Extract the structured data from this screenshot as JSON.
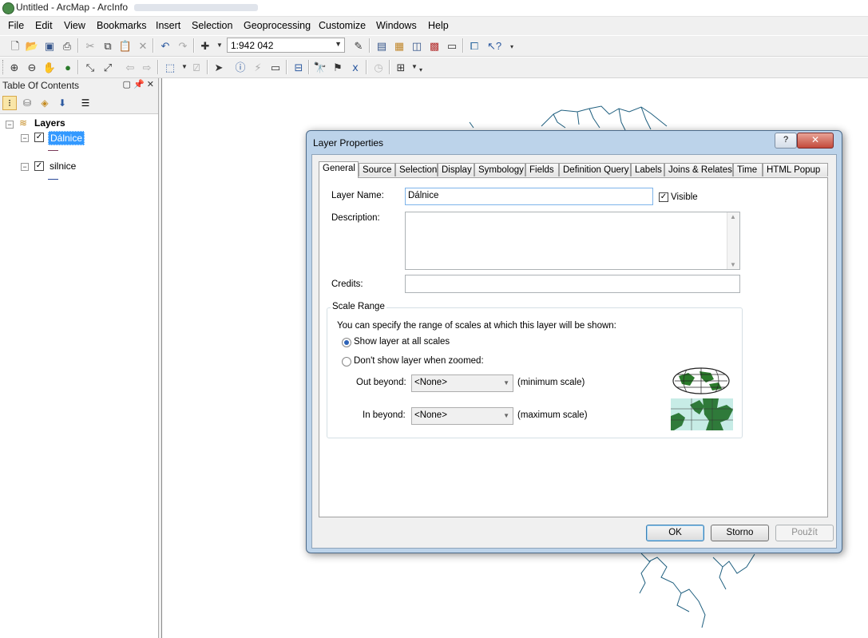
{
  "window": {
    "title": "Untitled - ArcMap - ArcInfo"
  },
  "menu": [
    "File",
    "Edit",
    "View",
    "Bookmarks",
    "Insert",
    "Selection",
    "Geoprocessing",
    "Customize",
    "Windows",
    "Help"
  ],
  "toolbar": {
    "scale_value": "1:942 042"
  },
  "toc": {
    "title": "Table Of Contents",
    "root": "Layers",
    "layers": [
      {
        "name": "Dálnice",
        "checked": true,
        "selected": true,
        "symbol_color": "#7a3a5a"
      },
      {
        "name": "silnice",
        "checked": true,
        "selected": false,
        "symbol_color": "#2a4a9a"
      }
    ]
  },
  "map": {
    "feature_color": "#1f5f7f"
  },
  "dialog": {
    "title": "Layer Properties",
    "help_glyph": "?",
    "close_glyph": "✕",
    "tabs": [
      "General",
      "Source",
      "Selection",
      "Display",
      "Symbology",
      "Fields",
      "Definition Query",
      "Labels",
      "Joins & Relates",
      "Time",
      "HTML Popup"
    ],
    "active_tab": "General",
    "general": {
      "layer_name_label": "Layer Name:",
      "layer_name_value": "Dálnice",
      "visible_label": "Visible",
      "visible_checked": true,
      "description_label": "Description:",
      "description_value": "",
      "credits_label": "Credits:",
      "credits_value": "",
      "scale_range_title": "Scale Range",
      "scale_range_hint": "You can specify the range of scales at which this layer will be shown:",
      "option_all_scales": "Show layer at all scales",
      "option_zoomed": "Don't show layer when zoomed:",
      "selected_option": "all",
      "out_beyond_label": "Out beyond:",
      "out_beyond_value": "<None>",
      "out_beyond_note": "(minimum scale)",
      "in_beyond_label": "In beyond:",
      "in_beyond_value": "<None>",
      "in_beyond_note": "(maximum scale)"
    },
    "buttons": {
      "ok": "OK",
      "cancel": "Storno",
      "apply": "Použít"
    }
  }
}
